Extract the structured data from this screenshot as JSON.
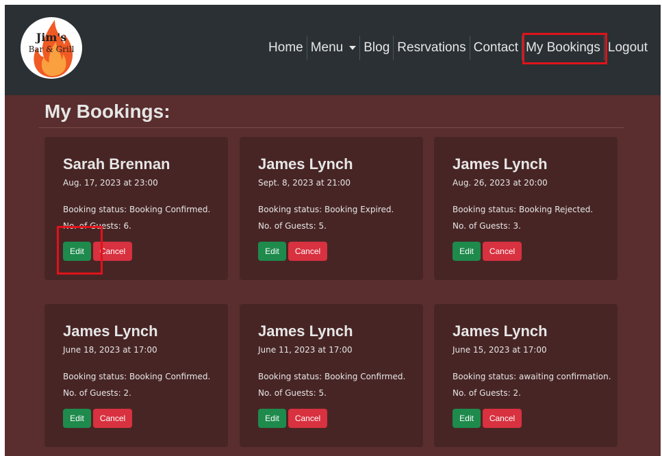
{
  "logo": {
    "line1": "Jim's",
    "line2": "Bar & Grill"
  },
  "nav": {
    "home": "Home",
    "menu": "Menu",
    "blog": "Blog",
    "reservations": "Resrvations",
    "contact": "Contact",
    "my_bookings": "My Bookings",
    "logout": "Logout"
  },
  "page": {
    "title": "My Bookings:"
  },
  "buttons": {
    "edit": "Edit",
    "cancel": "Cancel"
  },
  "bookings": [
    {
      "name": "Sarah Brennan",
      "date": "Aug. 17, 2023 at 23:00",
      "status": "Booking status: Booking Confirmed.",
      "guests": "No. of Guests: 6."
    },
    {
      "name": "James Lynch",
      "date": "Sept. 8, 2023 at 21:00",
      "status": "Booking status: Booking Expired.",
      "guests": "No. of Guests: 5."
    },
    {
      "name": "James Lynch",
      "date": "Aug. 26, 2023 at 20:00",
      "status": "Booking status: Booking Rejected.",
      "guests": "No. of Guests: 3."
    },
    {
      "name": "James Lynch",
      "date": "June 18, 2023 at 17:00",
      "status": "Booking status: Booking Confirmed.",
      "guests": "No. of Guests: 2."
    },
    {
      "name": "James Lynch",
      "date": "June 11, 2023 at 17:00",
      "status": "Booking status: Booking Confirmed.",
      "guests": "No. of Guests: 5."
    },
    {
      "name": "James Lynch",
      "date": "June 15, 2023 at 17:00",
      "status": "Booking status: awaiting confirmation.",
      "guests": "No. of Guests: 2."
    }
  ],
  "colors": {
    "navbar_bg": "#2a3034",
    "page_bg": "#5a2e2e",
    "card_bg": "#482525",
    "edit_button": "#1e8a4c",
    "cancel_button": "#d8313f",
    "highlight": "#e0131a"
  }
}
